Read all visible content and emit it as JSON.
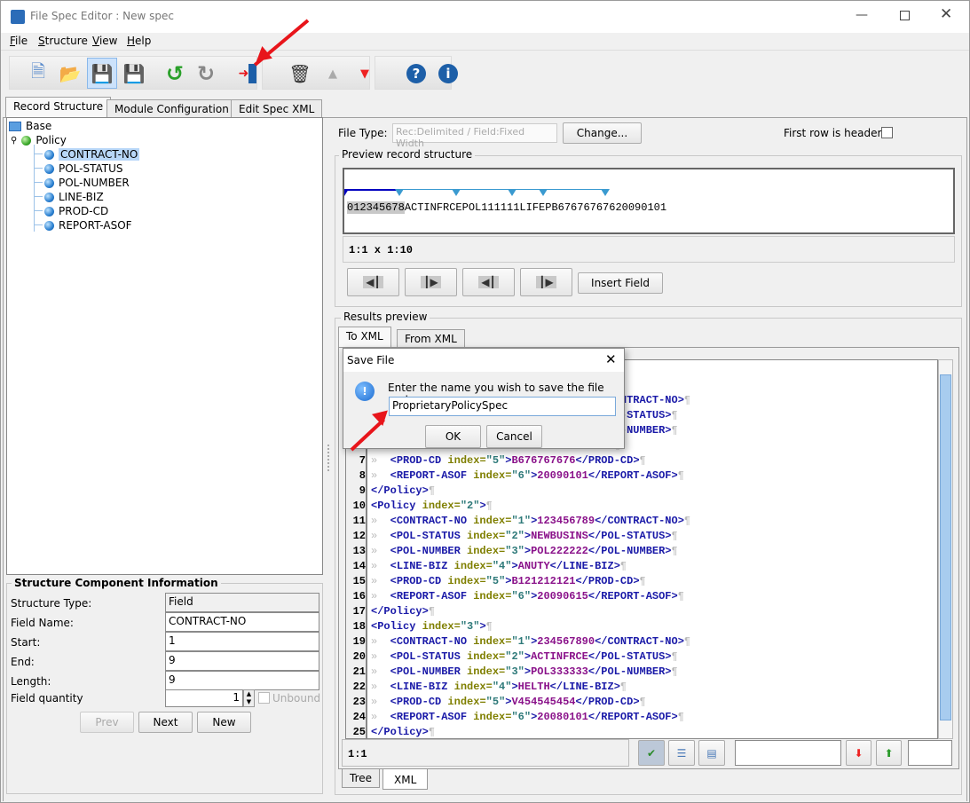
{
  "window": {
    "title": "File Spec Editor : New spec"
  },
  "menu": [
    "File",
    "Structure",
    "View",
    "Help"
  ],
  "toolbar": {
    "new": "new-spec-icon",
    "open": "open-icon",
    "save": "save-icon",
    "save_as": "save-as-icon",
    "undo": "undo-icon",
    "redo": "redo-icon",
    "exit": "exit-icon",
    "delete": "trash-icon",
    "up": "move-up-icon",
    "down": "move-down-icon",
    "help": "help-icon",
    "info": "info-icon"
  },
  "tabs": [
    "Record Structure",
    "Module Configuration",
    "Edit Spec XML"
  ],
  "tree": {
    "root": "Base",
    "record": "Policy",
    "fields": [
      "CONTRACT-NO",
      "POL-STATUS",
      "POL-NUMBER",
      "LINE-BIZ",
      "PROD-CD",
      "REPORT-ASOF"
    ],
    "selected": "CONTRACT-NO"
  },
  "component": {
    "title": "Structure Component Information",
    "rows": [
      {
        "label": "Structure Type:",
        "value": "Field"
      },
      {
        "label": "Field Name:",
        "value": "CONTRACT-NO"
      },
      {
        "label": "Start:",
        "value": "1"
      },
      {
        "label": "End:",
        "value": "9"
      },
      {
        "label": "Length:",
        "value": "9"
      }
    ],
    "qty_label": "Field quantity",
    "qty": "1",
    "unbound": "Unbound",
    "unbound_checked": false,
    "prev": "Prev",
    "next": "Next",
    "new": "New"
  },
  "filetype": {
    "label": "File Type:",
    "value": "Rec:Delimited / Field:Fixed Width",
    "change": "Change...",
    "first_row": "First row is headers",
    "first_row_checked": false
  },
  "preview": {
    "title": "Preview record structure",
    "selected": "012345678",
    "rest": "ACTINFRCEPOL111111LIFEPB67676767620090101",
    "position": "1:1 x 1:10",
    "insert": "Insert Field"
  },
  "results": {
    "title": "Results preview",
    "tabs": [
      "To XML",
      "From XML"
    ],
    "status": "1:1",
    "bottom_tabs": [
      "Tree",
      "XML"
    ],
    "lines": [
      {
        "n": 1,
        "i": 0,
        "raw": ""
      },
      {
        "n": 2,
        "i": 0,
        "tag": "Policy",
        "index": "1",
        "open": true
      },
      {
        "n": 3,
        "i": 1,
        "tag": "CONTRACT-NO",
        "index": "1",
        "val": "012345678"
      },
      {
        "n": 4,
        "i": 1,
        "tag": "POL-STATUS",
        "index": "2",
        "val": "ACTINFRCE"
      },
      {
        "n": 5,
        "i": 1,
        "tag": "POL-NUMBER",
        "index": "3",
        "val": "POL111111"
      },
      {
        "n": 6,
        "i": 1,
        "tag": "LINE-BIZ",
        "index": "4",
        "val": "LIFE"
      },
      {
        "n": 7,
        "i": 1,
        "tag": "PROD-CD",
        "index": "5",
        "val": "B676767676"
      },
      {
        "n": 8,
        "i": 1,
        "tag": "REPORT-ASOF",
        "index": "6",
        "val": "20090101"
      },
      {
        "n": 9,
        "i": 0,
        "close": "Policy"
      },
      {
        "n": 10,
        "i": 0,
        "tag": "Policy",
        "index": "2",
        "open": true
      },
      {
        "n": 11,
        "i": 1,
        "tag": "CONTRACT-NO",
        "index": "1",
        "val": "123456789"
      },
      {
        "n": 12,
        "i": 1,
        "tag": "POL-STATUS",
        "index": "2",
        "val": "NEWBUSINS"
      },
      {
        "n": 13,
        "i": 1,
        "tag": "POL-NUMBER",
        "index": "3",
        "val": "POL222222"
      },
      {
        "n": 14,
        "i": 1,
        "tag": "LINE-BIZ",
        "index": "4",
        "val": "ANUTY"
      },
      {
        "n": 15,
        "i": 1,
        "tag": "PROD-CD",
        "index": "5",
        "val": "B121212121"
      },
      {
        "n": 16,
        "i": 1,
        "tag": "REPORT-ASOF",
        "index": "6",
        "val": "20090615"
      },
      {
        "n": 17,
        "i": 0,
        "close": "Policy"
      },
      {
        "n": 18,
        "i": 0,
        "tag": "Policy",
        "index": "3",
        "open": true
      },
      {
        "n": 19,
        "i": 1,
        "tag": "CONTRACT-NO",
        "index": "1",
        "val": "234567890"
      },
      {
        "n": 20,
        "i": 1,
        "tag": "POL-STATUS",
        "index": "2",
        "val": "ACTINFRCE"
      },
      {
        "n": 21,
        "i": 1,
        "tag": "POL-NUMBER",
        "index": "3",
        "val": "POL333333"
      },
      {
        "n": 22,
        "i": 1,
        "tag": "LINE-BIZ",
        "index": "4",
        "val": "HELTH"
      },
      {
        "n": 23,
        "i": 1,
        "tag": "PROD-CD",
        "index": "5",
        "val": "V454545454"
      },
      {
        "n": 24,
        "i": 1,
        "tag": "REPORT-ASOF",
        "index": "6",
        "val": "20080101"
      },
      {
        "n": 25,
        "i": 0,
        "close": "Policy"
      }
    ]
  },
  "dialog": {
    "title": "Save File",
    "prompt": "Enter the name you wish to save the file under:",
    "value": "ProprietaryPolicySpec",
    "ok": "OK",
    "cancel": "Cancel"
  },
  "colors": {
    "annotation_arrow": "#e8151b",
    "selection": "#b8d7f8",
    "xml_tag": "#1a1aa8",
    "xml_attr": "#7f7f00",
    "xml_value": "#2f7a7a",
    "xml_text": "#8a128a"
  }
}
